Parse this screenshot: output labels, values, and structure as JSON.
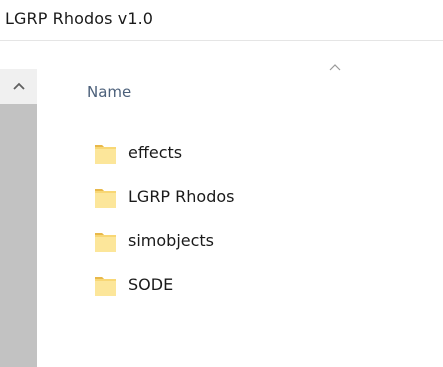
{
  "window": {
    "address": "LGRP Rhodos  v1.0"
  },
  "scrollbar": {
    "up_icon": "chevron-up-icon"
  },
  "list": {
    "column_header": "Name",
    "sort_icon": "sort-ascending-icon",
    "items": [
      {
        "label": "effects",
        "icon": "folder-icon"
      },
      {
        "label": "LGRP Rhodos",
        "icon": "folder-icon"
      },
      {
        "label": "simobjects",
        "icon": "folder-icon"
      },
      {
        "label": "SODE",
        "icon": "folder-icon"
      }
    ]
  },
  "colors": {
    "folder_body": "#f8d775",
    "folder_tab": "#e8b84a",
    "header_text": "#4c607a",
    "scroll_thumb": "#c2c2c2"
  }
}
